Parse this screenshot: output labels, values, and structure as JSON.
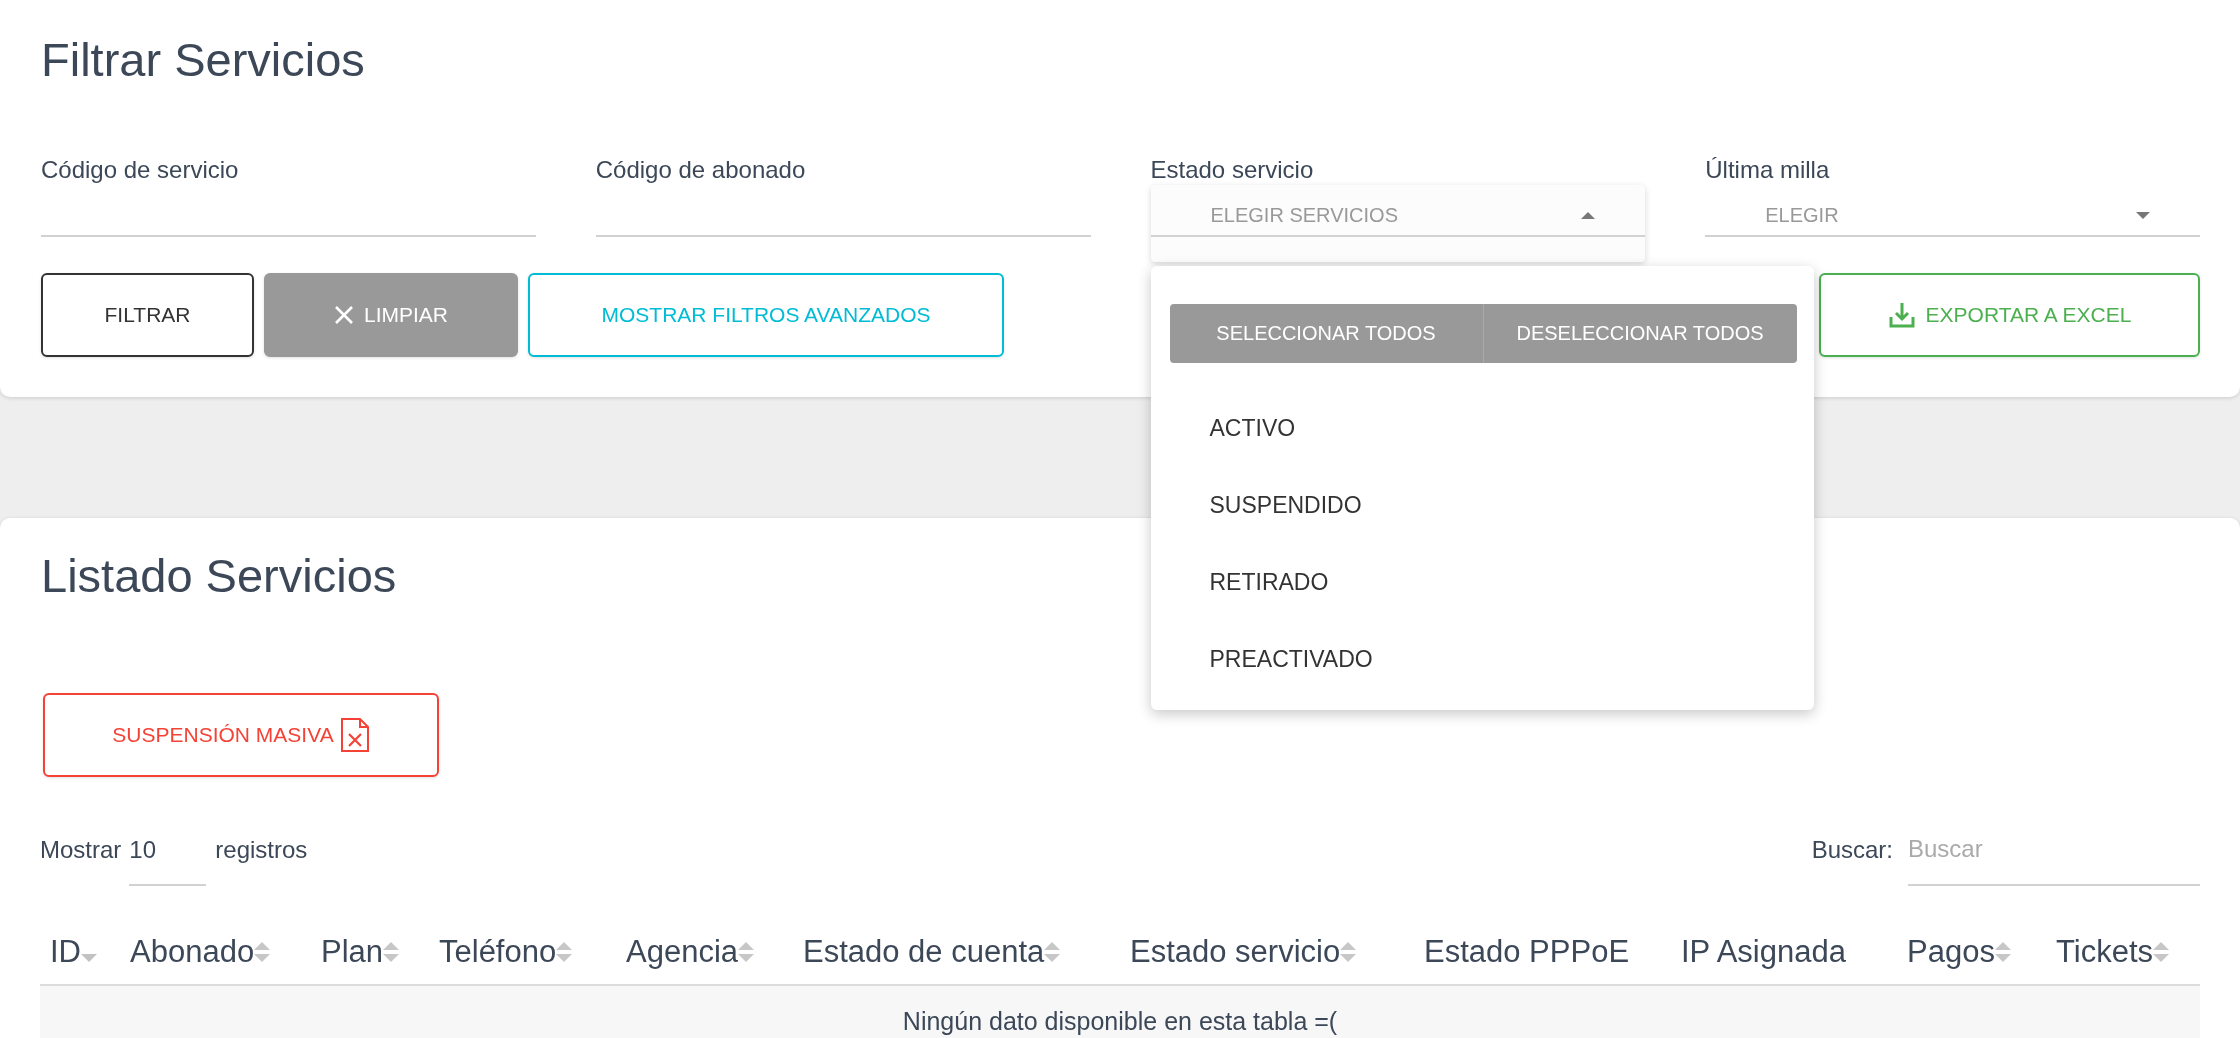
{
  "filter_panel": {
    "title": "Filtrar Servicios",
    "fields": [
      {
        "kind": "text",
        "label": "Código de servicio"
      },
      {
        "kind": "text",
        "label": "Código de abonado"
      },
      {
        "kind": "select",
        "label": "Estado servicio",
        "placeholder": "ELEGIR SERVICIOS",
        "open": true,
        "menu": {
          "actions": [
            "SELECCIONAR TODOS",
            "DESELECCIONAR TODOS"
          ],
          "options": [
            {
              "label": "ACTIVO",
              "selected": false
            },
            {
              "label": "SUSPENDIDO",
              "selected": false
            },
            {
              "label": "RETIRADO",
              "selected": false
            },
            {
              "label": "PREACTIVADO",
              "selected": false
            }
          ]
        }
      },
      {
        "kind": "select",
        "label": "Última milla",
        "placeholder": "ELEGIR",
        "open": false
      }
    ],
    "buttons": [
      {
        "kind": "filter",
        "label": "FILTRAR"
      },
      {
        "kind": "clear",
        "label": "LIMPIAR"
      },
      {
        "kind": "advanced",
        "label": "MOSTRAR FILTROS AVANZADOS"
      },
      {
        "kind": "export",
        "label": "EXPORTAR A EXCEL"
      }
    ]
  },
  "list_panel": {
    "title": "Listado Servicios",
    "bulk_button": {
      "label": "SUSPENSIÓN MASIVA"
    },
    "page_size": {
      "label": "Mostrar",
      "value": "10",
      "suffix": "registros"
    },
    "search": {
      "label": "Buscar:",
      "placeholder": "Buscar"
    },
    "table": {
      "columns": [
        {
          "label": "ID",
          "sortable": true,
          "sorted": true
        },
        {
          "label": "Abonado",
          "sortable": true,
          "sorted": false
        },
        {
          "label": "Plan",
          "sortable": true,
          "sorted": false
        },
        {
          "label": "Teléfono",
          "sortable": true,
          "sorted": false
        },
        {
          "label": "Agencia",
          "sortable": true,
          "sorted": false
        },
        {
          "label": "Estado de cuenta",
          "sortable": true,
          "sorted": false
        },
        {
          "label": "Estado servicio",
          "sortable": true,
          "sorted": false
        },
        {
          "label": "Estado PPPoE",
          "sortable": false,
          "sorted": false
        },
        {
          "label": "IP Asignada",
          "sortable": false,
          "sorted": false
        },
        {
          "label": "Pagos",
          "sortable": true,
          "sorted": false
        },
        {
          "label": "Tickets",
          "sortable": true,
          "sorted": false
        }
      ],
      "empty_message": "Ningún dato disponible en esta tabla =("
    }
  }
}
